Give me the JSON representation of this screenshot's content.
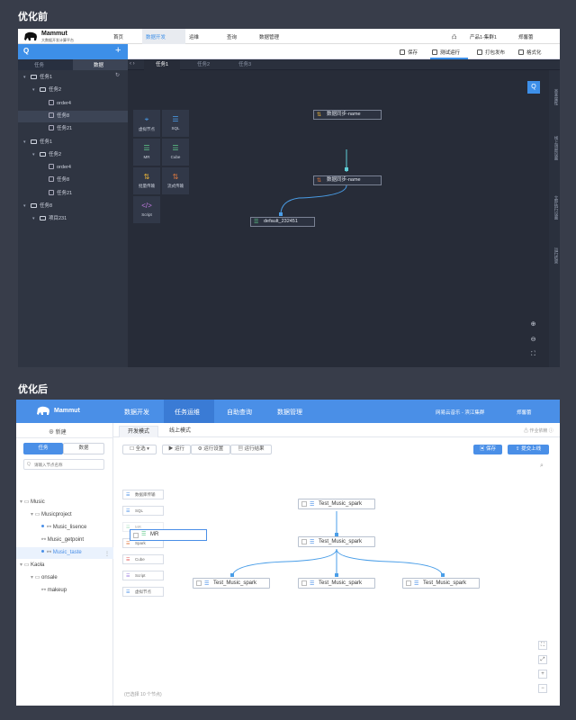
{
  "labels": {
    "before": "优化前",
    "after": "优化后"
  },
  "before": {
    "logo": {
      "title": "Mammut",
      "subtitle": "大数据开发计算平台"
    },
    "nav": [
      "首页",
      "数据开发",
      "运维",
      "查询",
      "数据管理"
    ],
    "user": {
      "bell": "凸",
      "project": "产品1-集群1",
      "user": "郑馨蕾"
    },
    "toolbar": {
      "search": "Q",
      "add": "+",
      "save": "保存",
      "test_run": "测试运行",
      "publish": "打包发布",
      "format": "格式化"
    },
    "left_tabs": [
      "任务",
      "数据"
    ],
    "tree": [
      {
        "label": "任务1",
        "level": 0,
        "type": "folder"
      },
      {
        "label": "任务2",
        "level": 1,
        "type": "folder"
      },
      {
        "label": "order4",
        "level": 2,
        "type": "node"
      },
      {
        "label": "任务8",
        "level": 2,
        "type": "node",
        "selected": true
      },
      {
        "label": "任务21",
        "level": 2,
        "type": "node"
      },
      {
        "label": "任务1",
        "level": 0,
        "type": "folder"
      },
      {
        "label": "任务2",
        "level": 1,
        "type": "folder"
      },
      {
        "label": "order4",
        "level": 2,
        "type": "node"
      },
      {
        "label": "任务8",
        "level": 2,
        "type": "node"
      },
      {
        "label": "任务21",
        "level": 2,
        "type": "node"
      },
      {
        "label": "任务8",
        "level": 0,
        "type": "folder"
      },
      {
        "label": "项目231",
        "level": 1,
        "type": "folder"
      }
    ],
    "editor_tabs": [
      "任务1",
      "任务2",
      "任务3"
    ],
    "palette": [
      {
        "label": "虚拟节点",
        "icon": "⌖"
      },
      {
        "label": "SQL",
        "icon": "☰"
      },
      {
        "label": "MR",
        "icon": "☰"
      },
      {
        "label": "Cube",
        "icon": "☰"
      },
      {
        "label": "批量传输",
        "icon": "⇅"
      },
      {
        "label": "流式传输",
        "icon": "⇅"
      },
      {
        "label": "Script",
        "icon": "</>"
      }
    ],
    "nodes": [
      "数据同步-name",
      "数据同步-name",
      "default_232451"
    ],
    "right_tabs": [
      "基本属性",
      "线上调度设置",
      "立即执行设置",
      "运行结果"
    ],
    "zoom": {
      "in": "⊕",
      "out": "⊖",
      "fit": "⛶"
    }
  },
  "after": {
    "logo": "Mammut",
    "nav": [
      "数据开发",
      "任务运维",
      "自助查询",
      "数据管理"
    ],
    "project": "网易云音乐 - 滨江集群",
    "user": "郑馨蕾",
    "new_button": "⊕ 新建",
    "side_tabs": [
      "任务",
      "数据"
    ],
    "search_placeholder": "请输入节点名称",
    "tree": [
      {
        "label": "Music",
        "level": 0,
        "type": "folder"
      },
      {
        "label": "Musicproject",
        "level": 1,
        "type": "folder"
      },
      {
        "label": "Music_lisence",
        "level": 2,
        "type": "node",
        "dot": true
      },
      {
        "label": "Music_getpoint",
        "level": 2,
        "type": "node"
      },
      {
        "label": "Music_taste",
        "level": 2,
        "type": "node",
        "dot": true,
        "selected": true
      },
      {
        "label": "Kaola",
        "level": 0,
        "type": "folder"
      },
      {
        "label": "onsale",
        "level": 1,
        "type": "folder"
      },
      {
        "label": "makeup",
        "level": 2,
        "type": "node"
      }
    ],
    "mode_tabs": [
      "开发模式",
      "线上模式"
    ],
    "job_link": "作业依赖",
    "toolbar": {
      "select_all": "全选",
      "run": "运行",
      "run_settings": "运行设置",
      "run_result": "运行结果",
      "save": "保存",
      "submit": "提交上线"
    },
    "palette": [
      "数据库传输",
      "SQL",
      "MR",
      "Spark",
      "Cube",
      "Script",
      "虚拟节点"
    ],
    "drag_node": "MR",
    "nodes": [
      "Test_Music_spark",
      "Test_Music_spark",
      "Test_Music_spark",
      "Test_Music_spark",
      "Test_Music_spark"
    ],
    "status": "(已选择 10 个节点)"
  }
}
